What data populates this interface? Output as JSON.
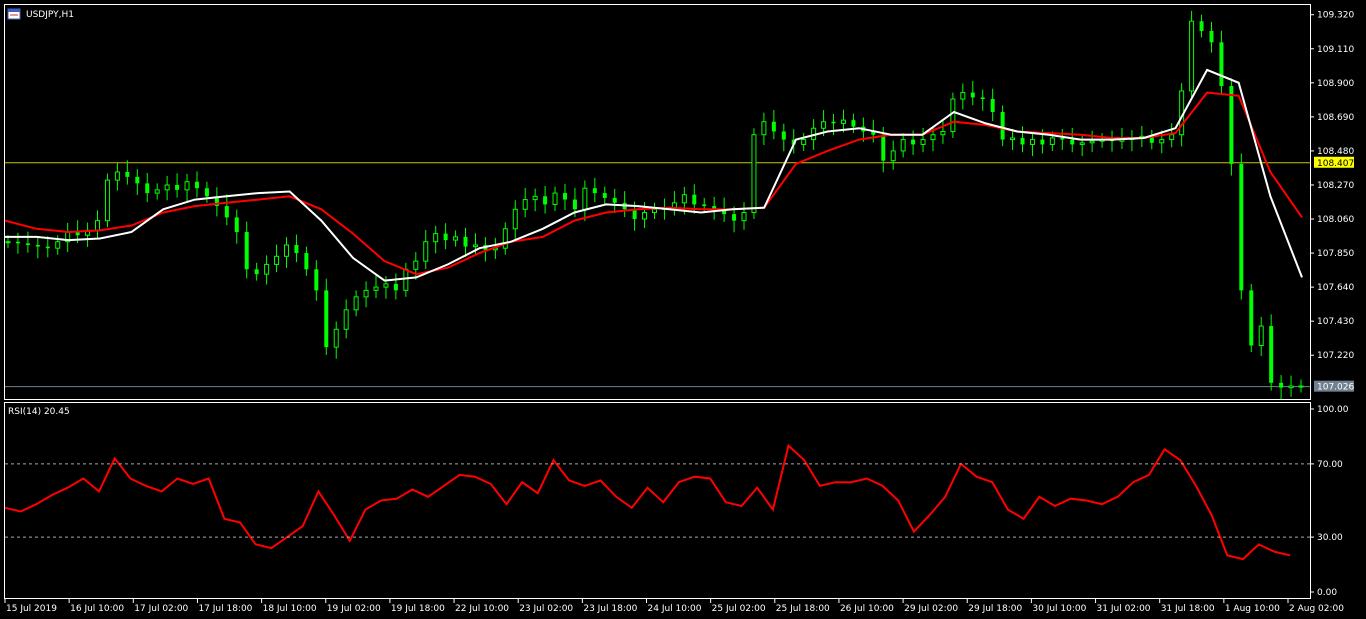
{
  "main_window": {
    "title": "USDJPY,H1",
    "icon": "chart-window-icon"
  },
  "indicator_window": {
    "title": "RSI(14) 20.45"
  },
  "colors": {
    "background": "#000000",
    "frame": "#ffffff",
    "bull_candle": "#00ff00",
    "bear_candle": "#00ff00",
    "ma_fast": "#ffffff",
    "ma_slow": "#ff0000",
    "rsi_line": "#ff0000",
    "hline_yellow": "#c8c800",
    "hline_gray": "#708090",
    "label_yellow_bg": "#ffff00",
    "label_gray_bg": "#708090"
  },
  "chart_data": [
    {
      "type": "candlestick",
      "symbol": "USDJPY",
      "timeframe": "H1",
      "title": "USDJPY,H1",
      "y_ticks": [
        "109.320",
        "109.110",
        "108.900",
        "108.690",
        "108.480",
        "108.270",
        "108.060",
        "107.850",
        "107.640",
        "107.430",
        "107.220",
        "107.026"
      ],
      "ylim": [
        106.95,
        109.38
      ],
      "horizontal_lines": [
        {
          "price": 108.407,
          "label": "108.407",
          "color": "yellow"
        },
        {
          "price": 107.026,
          "label": "107.026",
          "color": "gray"
        }
      ],
      "series": [
        {
          "role": "close_approx",
          "x": [
            0,
            10,
            20,
            30,
            40,
            50,
            60,
            70,
            80,
            90,
            100,
            110,
            120,
            130,
            140,
            150,
            160,
            170,
            180,
            190,
            200,
            210,
            220,
            230,
            240,
            250,
            260,
            270,
            280,
            290,
            300,
            310,
            320,
            330,
            340,
            350,
            360,
            370,
            380,
            390,
            400,
            410,
            420,
            430,
            440,
            450,
            460,
            470,
            480,
            490,
            500,
            510,
            520,
            530,
            540,
            550,
            560,
            570,
            580,
            590,
            600,
            610,
            620,
            630,
            640,
            650,
            660,
            670,
            680,
            690,
            700,
            710,
            720,
            730,
            740,
            750,
            760,
            770,
            780,
            790,
            800,
            810,
            820,
            830,
            840,
            850,
            860,
            870,
            880,
            890,
            900,
            910,
            920,
            930,
            940,
            950,
            960,
            970,
            980,
            990,
            1000,
            1010,
            1020,
            1030,
            1040,
            1050,
            1060,
            1070,
            1080,
            1090,
            1100,
            1110,
            1120,
            1130,
            1140,
            1150,
            1160,
            1170,
            1180,
            1190,
            1200,
            1210,
            1220,
            1230,
            1240,
            1250,
            1260,
            1270,
            1280,
            1290,
            1300
          ],
          "values": [
            107.92,
            107.91,
            107.9,
            107.89,
            107.88,
            107.92,
            107.98,
            107.96,
            107.99,
            108.05,
            108.3,
            108.35,
            108.32,
            108.28,
            108.22,
            108.24,
            108.27,
            108.24,
            108.29,
            108.25,
            108.2,
            108.14,
            108.07,
            107.98,
            107.75,
            107.72,
            107.78,
            107.83,
            107.9,
            107.85,
            107.75,
            107.62,
            107.27,
            107.38,
            107.5,
            107.58,
            107.62,
            107.64,
            107.66,
            107.62,
            107.75,
            107.8,
            107.92,
            107.97,
            107.93,
            107.95,
            107.89,
            107.9,
            107.87,
            107.88,
            108.0,
            108.12,
            108.18,
            108.2,
            108.15,
            108.22,
            108.18,
            108.12,
            108.25,
            108.22,
            108.19,
            108.16,
            108.12,
            108.06,
            108.1,
            108.12,
            108.13,
            108.16,
            108.21,
            108.15,
            108.14,
            108.12,
            108.09,
            108.05,
            108.1,
            108.58,
            108.66,
            108.6,
            108.55,
            108.52,
            108.55,
            108.62,
            108.66,
            108.65,
            108.67,
            108.63,
            108.6,
            108.58,
            108.42,
            108.48,
            108.55,
            108.52,
            108.55,
            108.58,
            108.6,
            108.8,
            108.84,
            108.81,
            108.8,
            108.72,
            108.55,
            108.56,
            108.52,
            108.55,
            108.52,
            108.56,
            108.55,
            108.52,
            108.53,
            108.54,
            108.55,
            108.54,
            108.55,
            108.56,
            108.57,
            108.53,
            108.55,
            108.58,
            108.85,
            109.28,
            109.22,
            109.15,
            108.88,
            108.4,
            107.62,
            107.28,
            107.4,
            107.05,
            107.02,
            107.03,
            107.03
          ]
        },
        {
          "name": "MA fast",
          "color": "white",
          "values": [
            107.95,
            107.95,
            107.93,
            107.94,
            107.98,
            108.12,
            108.18,
            108.2,
            108.22,
            108.23,
            108.05,
            107.82,
            107.68,
            107.7,
            107.78,
            107.88,
            107.92,
            108.0,
            108.1,
            108.15,
            108.14,
            108.12,
            108.1,
            108.12,
            108.13,
            108.55,
            108.6,
            108.62,
            108.58,
            108.58,
            108.72,
            108.65,
            108.6,
            108.58,
            108.55,
            108.55,
            108.56,
            108.62,
            108.98,
            108.9,
            108.2,
            107.7
          ]
        },
        {
          "name": "MA slow",
          "color": "red",
          "values": [
            108.05,
            108.0,
            107.98,
            107.99,
            108.02,
            108.1,
            108.14,
            108.16,
            108.18,
            108.2,
            108.12,
            107.97,
            107.8,
            107.72,
            107.76,
            107.85,
            107.92,
            107.95,
            108.05,
            108.1,
            108.12,
            108.13,
            108.12,
            108.12,
            108.13,
            108.4,
            108.48,
            108.55,
            108.58,
            108.58,
            108.66,
            108.64,
            108.6,
            108.59,
            108.58,
            108.56,
            108.56,
            108.59,
            108.84,
            108.82,
            108.35,
            108.07
          ]
        }
      ]
    },
    {
      "type": "line",
      "title": "RSI(14) 20.45",
      "y_ticks": [
        "100.00",
        "70.00",
        "30.00",
        "0.00"
      ],
      "ylim": [
        0,
        100
      ],
      "levels": [
        70,
        30
      ],
      "series": [
        {
          "name": "RSI(14)",
          "color": "red",
          "values": [
            46,
            44,
            48,
            53,
            57,
            62,
            55,
            73,
            62,
            58,
            55,
            62,
            59,
            62,
            40,
            38,
            26,
            24,
            30,
            36,
            55,
            42,
            28,
            45,
            50,
            51,
            56,
            52,
            58,
            64,
            63,
            59,
            48,
            60,
            54,
            72,
            61,
            58,
            61,
            52,
            46,
            57,
            49,
            60,
            63,
            62,
            49,
            47,
            57,
            45,
            80,
            72,
            58,
            60,
            60,
            62,
            58,
            50,
            33,
            42,
            52,
            70,
            63,
            60,
            45,
            40,
            52,
            47,
            51,
            50,
            48,
            52,
            60,
            64,
            78,
            72,
            58,
            42,
            20,
            18,
            26,
            22,
            20
          ]
        }
      ]
    }
  ],
  "x_axis": {
    "ticks": [
      "15 Jul 2019",
      "16 Jul 10:00",
      "17 Jul 02:00",
      "17 Jul 18:00",
      "18 Jul 10:00",
      "19 Jul 02:00",
      "19 Jul 18:00",
      "22 Jul 10:00",
      "23 Jul 02:00",
      "23 Jul 18:00",
      "24 Jul 10:00",
      "25 Jul 02:00",
      "25 Jul 18:00",
      "26 Jul 10:00",
      "29 Jul 02:00",
      "29 Jul 18:00",
      "30 Jul 10:00",
      "31 Jul 02:00",
      "31 Jul 18:00",
      "1 Aug 10:00",
      "2 Aug 02:00"
    ]
  }
}
